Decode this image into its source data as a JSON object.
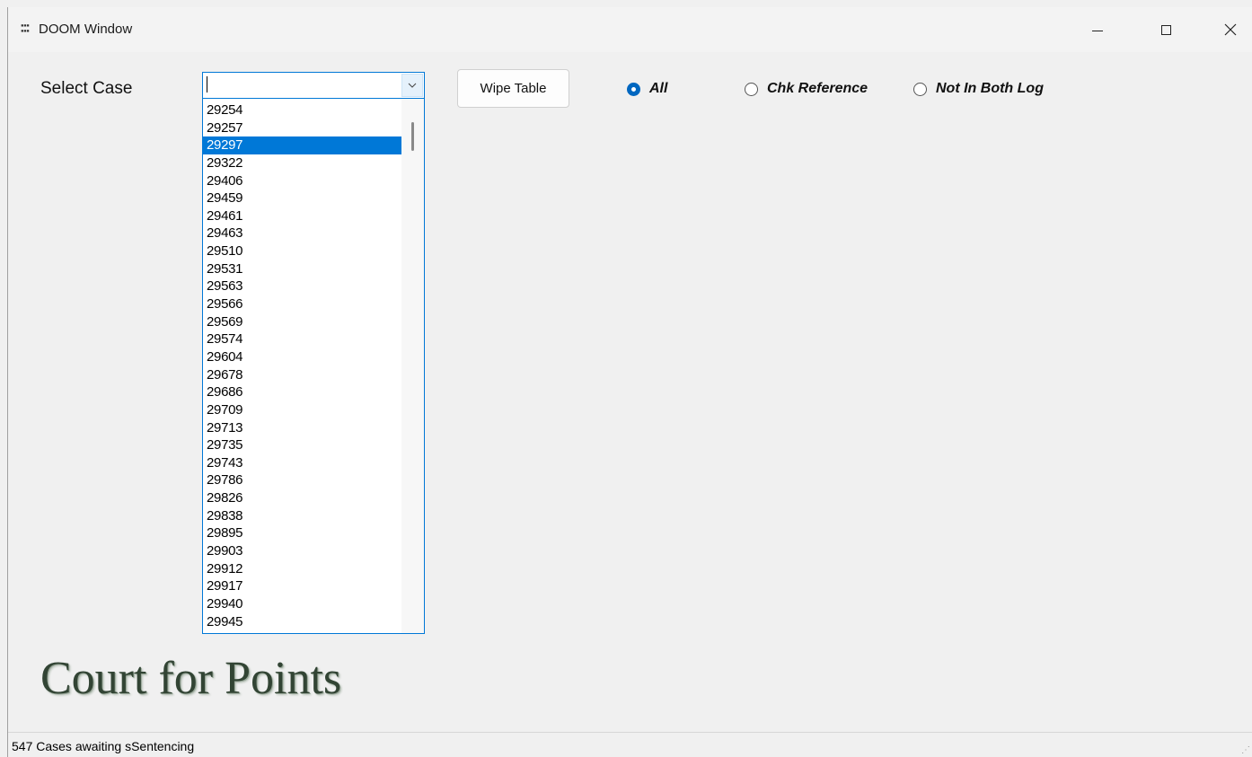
{
  "window": {
    "title": "DOOM Window",
    "icon_text": "DMW MS"
  },
  "form": {
    "select_label": "Select Case",
    "combo_value": "",
    "wipe_button": "Wipe Table",
    "radios": [
      {
        "label": "All",
        "checked": true
      },
      {
        "label": "Chk Reference",
        "checked": false
      },
      {
        "label": "Not In Both Log",
        "checked": false
      }
    ]
  },
  "dropdown": {
    "selected": "29297",
    "items": [
      "29254",
      "29257",
      "29297",
      "29322",
      "29406",
      "29459",
      "29461",
      "29463",
      "29510",
      "29531",
      "29563",
      "29566",
      "29569",
      "29574",
      "29604",
      "29678",
      "29686",
      "29709",
      "29713",
      "29735",
      "29743",
      "29786",
      "29826",
      "29838",
      "29895",
      "29903",
      "29912",
      "29917",
      "29940",
      "29945"
    ]
  },
  "banner": {
    "title": "Court for Points"
  },
  "status": {
    "text": "547 Cases awaiting sSentencing"
  }
}
